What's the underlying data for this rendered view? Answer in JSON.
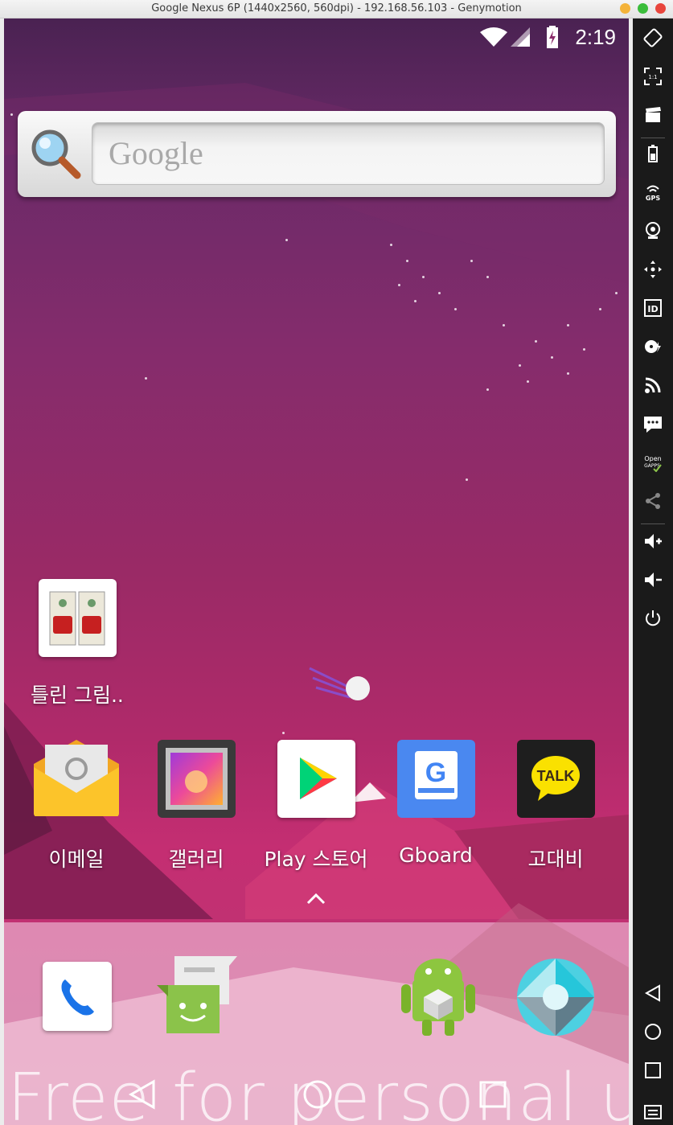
{
  "window": {
    "title": "Google Nexus 6P (1440x2560, 560dpi) - 192.168.56.103 - Genymotion"
  },
  "status": {
    "time": "2:19"
  },
  "search_widget": {
    "placeholder": "Google"
  },
  "home_apps": [
    {
      "label": "틀린 그림.."
    },
    {
      "label": "이메일"
    },
    {
      "label": "갤러리"
    },
    {
      "label": "Play 스토어"
    },
    {
      "label": "Gboard"
    },
    {
      "label": "고대비"
    }
  ],
  "kakao": {
    "icon_text": "TALK"
  },
  "watermark": "Free for personal use",
  "colors": {
    "accent": "#e1287a",
    "sidebar": "#1a1a1a"
  }
}
